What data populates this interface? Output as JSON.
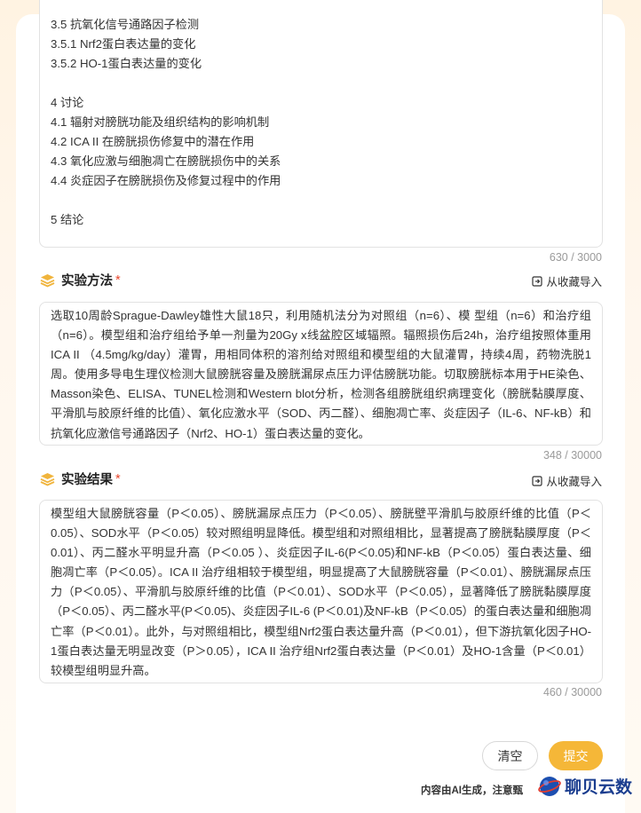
{
  "outline": {
    "lines": [
      "3.5 抗氧化信号通路因子检测",
      "3.5.1 Nrf2蛋白表达量的变化",
      "3.5.2 HO-1蛋白表达量的变化",
      "",
      "4 讨论",
      "4.1 辐射对膀胱功能及组织结构的影响机制",
      "4.2 ICA II 在膀胱损伤修复中的潜在作用",
      "4.3 氧化应激与细胞凋亡在膀胱损伤中的关系",
      "4.4 炎症因子在膀胱损伤及修复过程中的作用",
      "",
      "5 结论"
    ],
    "counter": "630 / 3000"
  },
  "method": {
    "title": "实验方法",
    "required_mark": "*",
    "import_label": "从收藏导入",
    "text": "选取10周龄Sprague-Dawley雄性大鼠18只，利用随机法分为对照组（n=6）、模 型组（n=6）和治疗组（n=6）。模型组和治疗组给予单一剂量为20Gy x线盆腔区域辐照。辐照损伤后24h，治疗组按照体重用ICA II （4.5mg/kg/day）灌胃，用相同体积的溶剂给对照组和模型组的大鼠灌胃，持续4周，药物洗脱1周。使用多导电生理仪检测大鼠膀胱容量及膀胱漏尿点压力评估膀胱功能。切取膀胱标本用于HE染色、Masson染色、ELISA、TUNEL检测和Western blot分析，检测各组膀胱组织病理变化（膀胱黏膜厚度、平滑肌与胶原纤维的比值）、氧化应激水平（SOD、丙二醛）、细胞凋亡率、炎症因子（IL-6、NF-kB）和抗氧化应激信号通路因子（Nrf2、HO-1）蛋白表达量的变化。",
    "counter": "348 / 30000"
  },
  "result": {
    "title": "实验结果",
    "required_mark": "*",
    "import_label": "从收藏导入",
    "text": "模型组大鼠膀胱容量（P＜0.05）、膀胱漏尿点压力（P＜0.05）、膀胱壁平滑肌与胶原纤维的比值（P＜0.05）、SOD水平（P＜0.05）较对照组明显降低。模型组和对照组相比，显著提高了膀胱黏膜厚度（P＜0.01）、丙二醛水平明显升高（P＜0.05 ）、炎症因子IL-6(P＜0.05)和NF-kB（P＜0.05）蛋白表达量、细胞凋亡率（P＜0.05）。ICA II 治疗组相较于模型组，明显提高了大鼠膀胱容量（P＜0.01）、膀胱漏尿点压力（P＜0.05）、平滑肌与胶原纤维的比值（P＜0.01）、SOD水平（P＜0.05），显著降低了膀胱黏膜厚度（P＜0.05）、丙二醛水平(P＜0.05)、炎症因子IL-6 (P＜0.01)及NF-kB（P＜0.05）的蛋白表达量和细胞凋亡率（P＜0.01）。此外，与对照组相比，模型组Nrf2蛋白表达量升高（P＜0.01），但下游抗氧化因子HO-1蛋白表达量无明显改变（P＞0.05），ICA II 治疗组Nrf2蛋白表达量（P＜0.01）及HO-1含量（P＜0.01）较模型组明显升高。",
    "counter": "460 / 30000"
  },
  "actions": {
    "clear_label": "清空",
    "submit_label": "提交"
  },
  "footer": {
    "disclaimer": "内容由AI生成，注意甄",
    "watermark": "聊贝云数"
  },
  "colors": {
    "accent": "#f5b738",
    "required": "#e8462c",
    "watermark": "#1a3d8f"
  },
  "icons": {
    "section": "layers-icon",
    "import": "import-icon",
    "watermark": "globe-icon"
  }
}
